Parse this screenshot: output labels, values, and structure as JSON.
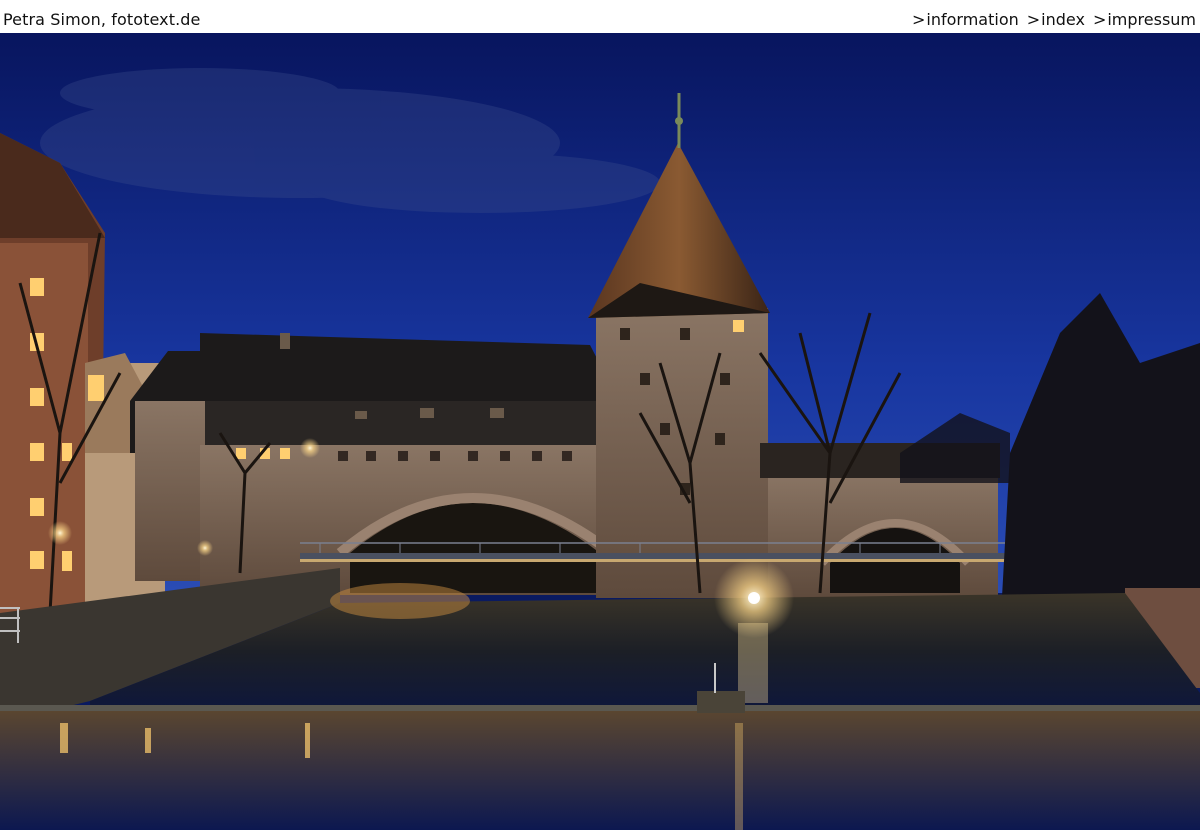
{
  "header": {
    "site_title": "Petra Simon, fototext.de",
    "nav": [
      {
        "prefix": ">",
        "label": "information"
      },
      {
        "prefix": ">",
        "label": "index"
      },
      {
        "prefix": ">",
        "label": "impressum"
      }
    ]
  },
  "photo": {
    "subject": "night-river-bridge-tower",
    "colors": {
      "sky_top": "#0a1a6e",
      "sky_bottom": "#1f3a9a",
      "stone": "#7a6656",
      "roof": "#2a2420",
      "water": "#1a1e2a",
      "light": "#ffd98a"
    }
  }
}
